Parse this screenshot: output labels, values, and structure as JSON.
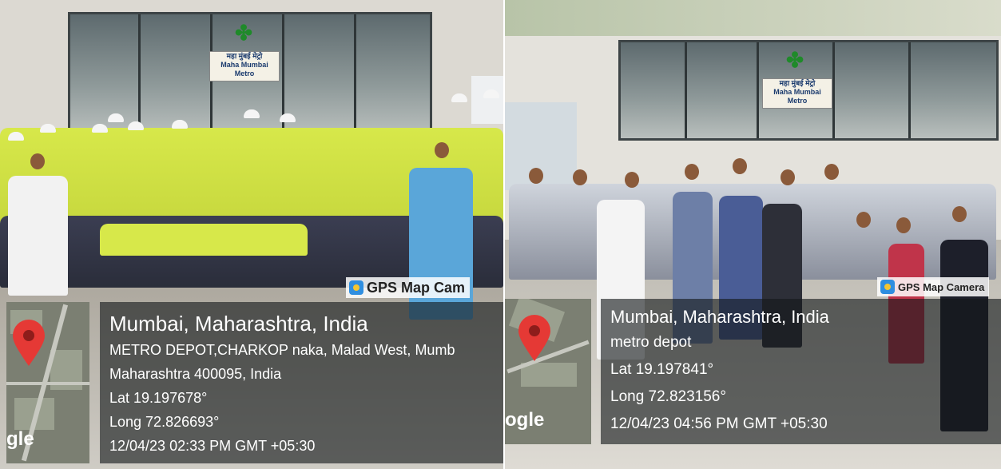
{
  "photo_left": {
    "sign_text": "महा मुंबई मेट्रो\nMaha Mumbai\nMetro",
    "badge": "GPS Map Cam",
    "map_watermark": "gle",
    "location_title": "Mumbai, Maharashtra, India",
    "address_line1": "METRO DEPOT,CHARKOP naka, Malad West, Mumb",
    "address_line2": "Maharashtra 400095, India",
    "lat": "Lat 19.197678°",
    "long": "Long 72.826693°",
    "datetime": "12/04/23 02:33 PM GMT +05:30"
  },
  "photo_right": {
    "sign_text": "महा मुंबई मेट्रो\nMaha Mumbai\nMetro",
    "badge": "GPS Map Camera",
    "map_watermark": "ogle",
    "location_title": "Mumbai, Maharashtra, India",
    "address_line1": "metro depot",
    "lat": "Lat 19.197841°",
    "long": "Long 72.823156°",
    "datetime": "12/04/23 04:56 PM GMT +05:30"
  },
  "colors": {
    "pin": "#e53935",
    "vest": "#d7e84a",
    "overlay": "#14181a"
  }
}
